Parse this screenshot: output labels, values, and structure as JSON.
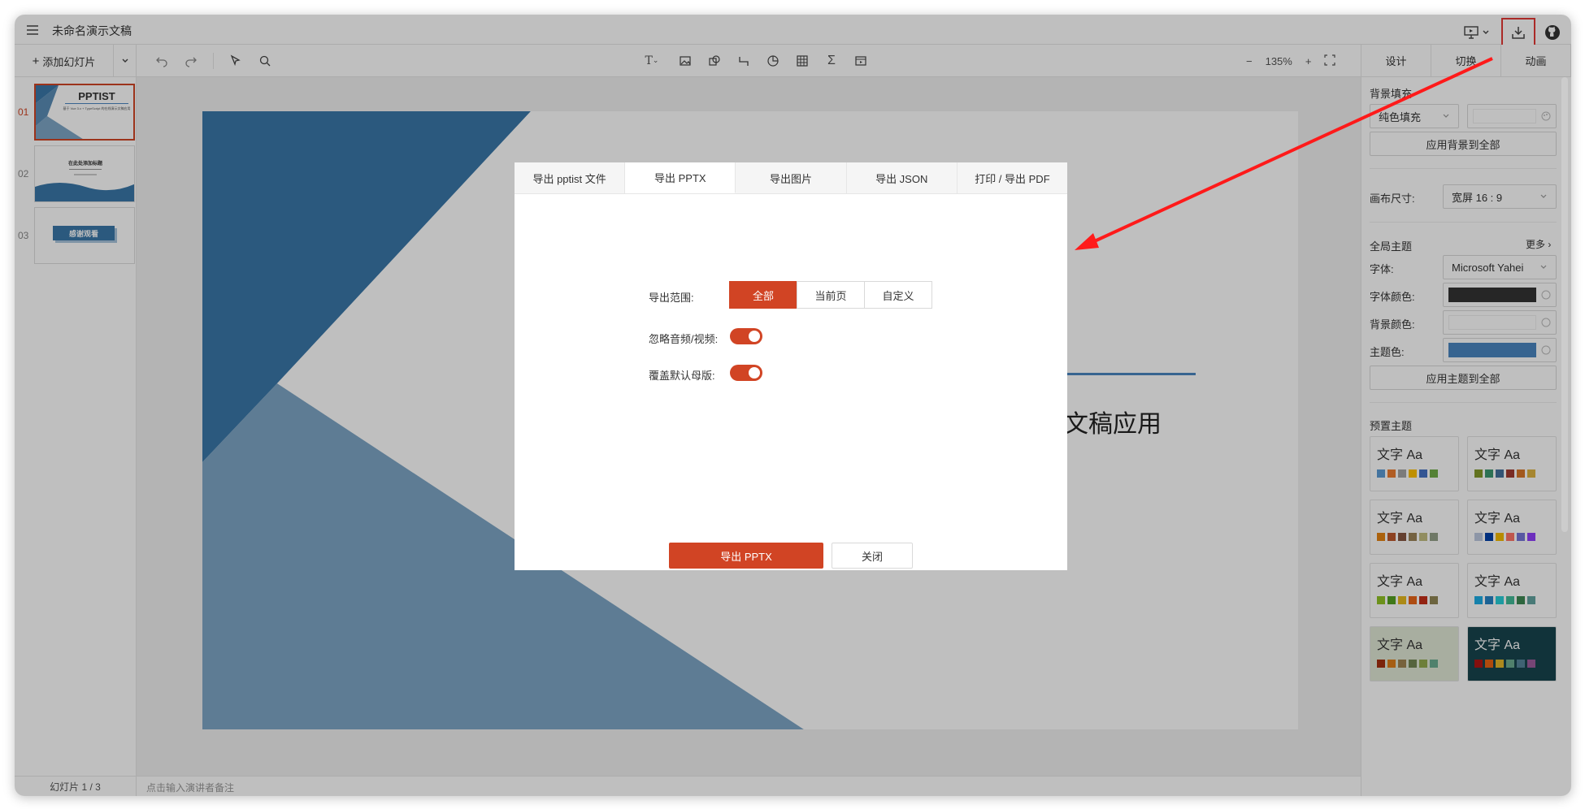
{
  "app": {
    "title": "未命名演示文稿"
  },
  "toolbar": {
    "add_slide": "添加幻灯片",
    "zoom": "135%"
  },
  "right_tabs": [
    "设计",
    "切换",
    "动画"
  ],
  "thumbs": [
    {
      "num": "01",
      "title": "PPTIST",
      "subtitle": "基于 Vue 3.x + TypeScript 的在线演示文稿应用"
    },
    {
      "num": "02",
      "title": "在此处添加标题",
      "subtitle": ""
    },
    {
      "num": "03",
      "title": "感谢观看",
      "subtitle": ""
    }
  ],
  "slide": {
    "text": "文稿应用"
  },
  "notes": {
    "count": "幻灯片 1 / 3",
    "placeholder": "点击输入演讲者备注"
  },
  "panel": {
    "bg_fill_label": "背景填充",
    "bg_fill_value": "纯色填充",
    "apply_bg": "应用背景到全部",
    "canvas_size_label": "画布尺寸:",
    "canvas_size_value": "宽屏 16 : 9",
    "global_theme_label": "全局主题",
    "more": "更多",
    "font_label": "字体:",
    "font_value": "Microsoft Yahei",
    "font_color_label": "字体颜色:",
    "bg_color_label": "背景颜色:",
    "theme_color_label": "主题色:",
    "apply_theme": "应用主题到全部",
    "preset_label": "预置主题",
    "font_color": "#333333",
    "theme_color": "#4a86c0"
  },
  "themes": [
    {
      "title": "文字 Aa",
      "bg": "#ffffff",
      "fg": "#333333",
      "colors": [
        "#5b9bd5",
        "#ed7d31",
        "#a5a5a5",
        "#ffc000",
        "#4472c4",
        "#70ad47"
      ]
    },
    {
      "title": "文字 Aa",
      "bg": "#ffffff",
      "fg": "#333333",
      "colors": [
        "#83992a",
        "#3c9770",
        "#44709d",
        "#a23b32",
        "#d87728",
        "#deb340"
      ]
    },
    {
      "title": "文字 Aa",
      "bg": "#ffffff",
      "fg": "#333333",
      "colors": [
        "#e48312",
        "#bd582c",
        "#865640",
        "#9b8357",
        "#c2bc80",
        "#94a088"
      ]
    },
    {
      "title": "文字 Aa",
      "bg": "#ffffff",
      "fg": "#333333",
      "colors": [
        "#bdc8df",
        "#003fa9",
        "#f5ba00",
        "#ff7567",
        "#7676d9",
        "#923ffc"
      ]
    },
    {
      "title": "文字 Aa",
      "bg": "#ffffff",
      "fg": "#333333",
      "colors": [
        "#90c225",
        "#54a121",
        "#e6b91e",
        "#e86618",
        "#c42f19",
        "#918655"
      ]
    },
    {
      "title": "文字 Aa",
      "bg": "#ffffff",
      "fg": "#333333",
      "colors": [
        "#1cade4",
        "#2683c6",
        "#27ced7",
        "#42ba97",
        "#3e8853",
        "#62a39f"
      ]
    },
    {
      "title": "文字 Aa",
      "bg": "#e1e9d6",
      "fg": "#333333",
      "colors": [
        "#a5300f",
        "#de7e18",
        "#9f8351",
        "#728653",
        "#92aa4c",
        "#6aac91"
      ]
    },
    {
      "title": "文字 Aa",
      "bg": "#17444e",
      "fg": "#ffffff",
      "colors": [
        "#b01513",
        "#ea6312",
        "#e6b729",
        "#6bab90",
        "#55839a",
        "#9e5d9d"
      ]
    }
  ],
  "dialog": {
    "tabs": [
      "导出 pptist 文件",
      "导出 PPTX",
      "导出图片",
      "导出 JSON",
      "打印 / 导出 PDF"
    ],
    "range_label": "导出范围:",
    "range_options": [
      "全部",
      "当前页",
      "自定义"
    ],
    "ignore_media_label": "忽略音频/视频:",
    "override_master_label": "覆盖默认母版:",
    "export_button": "导出 PPTX",
    "close_button": "关闭"
  }
}
